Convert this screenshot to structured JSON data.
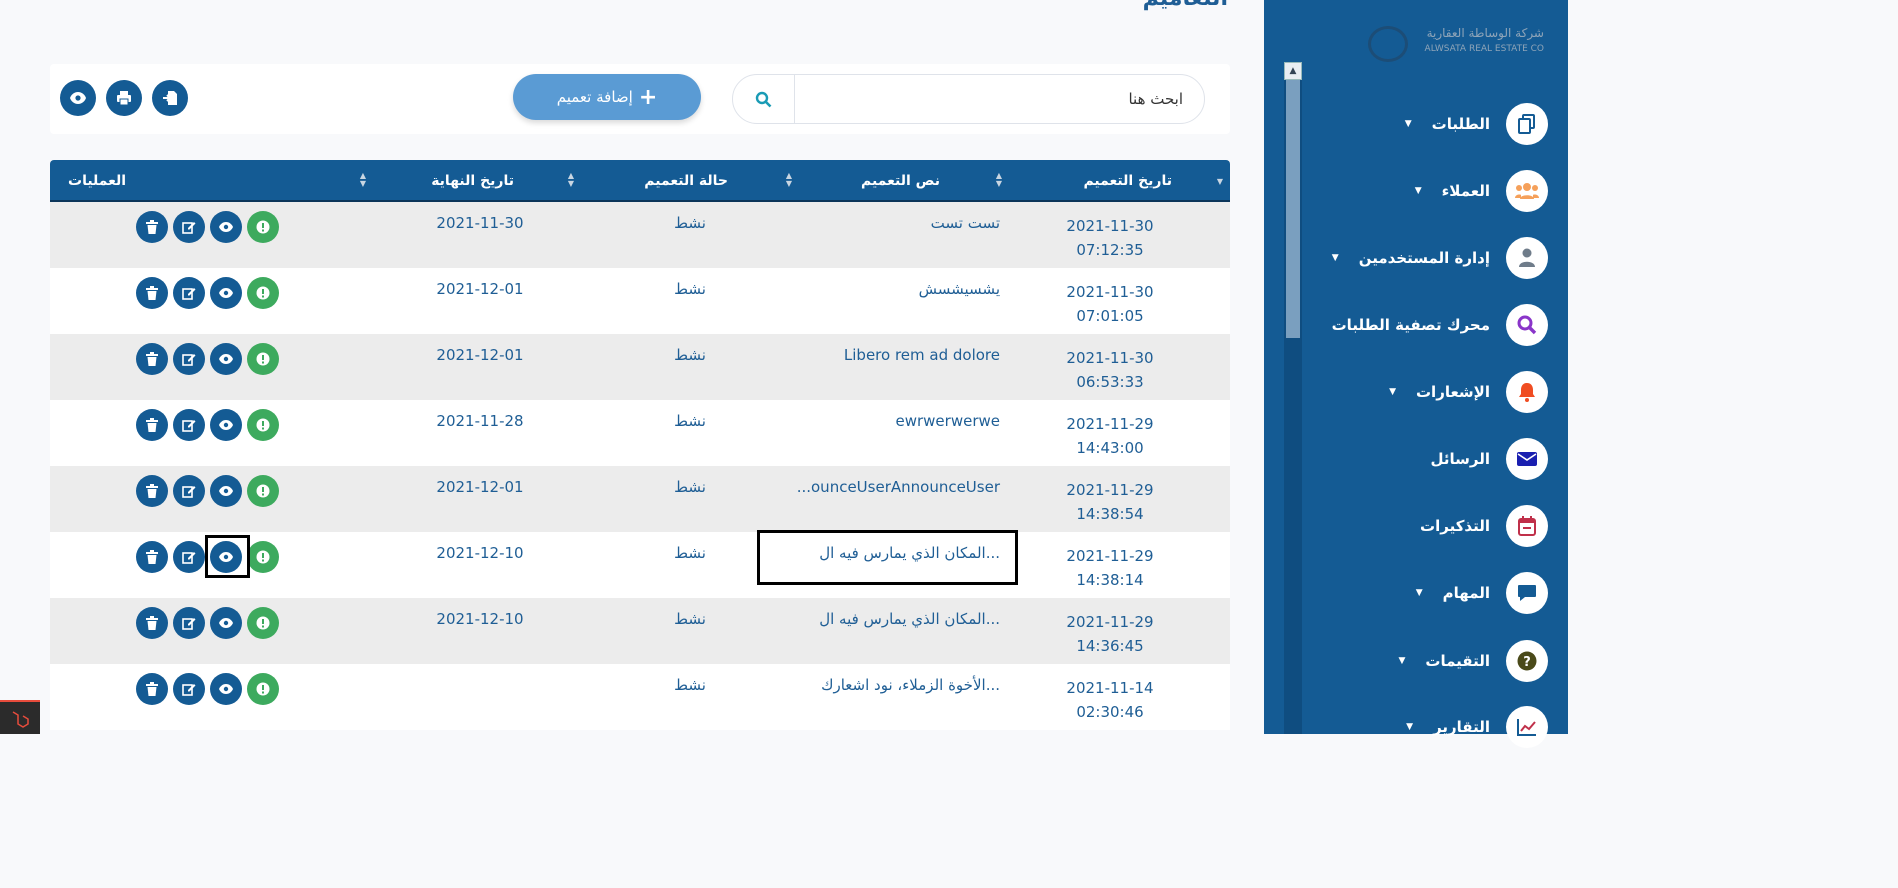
{
  "page": {
    "heading": "التعاميم"
  },
  "logo": {
    "line1": "شركة الوساطة العقارية",
    "line2": "ALWSATA REAL ESTATE CO"
  },
  "sidebar": {
    "items": [
      {
        "label": "الطلبات",
        "icon": "copy-icon",
        "has_caret": true
      },
      {
        "label": "العملاء",
        "icon": "users-icon",
        "has_caret": true
      },
      {
        "label": "إدارة المستخدمين",
        "icon": "user-icon",
        "has_caret": true
      },
      {
        "label": "محرك تصفية الطلبات",
        "icon": "search-icon",
        "has_caret": false
      },
      {
        "label": "الإشعارات",
        "icon": "bell-icon",
        "has_caret": true
      },
      {
        "label": "الرسائل",
        "icon": "envelope-icon",
        "has_caret": false
      },
      {
        "label": "التذكيرات",
        "icon": "calendar-icon",
        "has_caret": false
      },
      {
        "label": "المهام",
        "icon": "comment-icon",
        "has_caret": true
      },
      {
        "label": "التقيمات",
        "icon": "question-icon",
        "has_caret": true
      },
      {
        "label": "التقارير",
        "icon": "chart-icon",
        "has_caret": true
      }
    ]
  },
  "toolbar": {
    "search_placeholder": "ابحث هنا",
    "add_label": "إضافة تعميم",
    "buttons": [
      "export-icon",
      "print-icon",
      "eye-icon"
    ]
  },
  "table": {
    "headers": {
      "date": "تاريخ التعميم",
      "text": "نص التعميم",
      "status": "حالة التعميم",
      "end_date": "تاريخ النهاية",
      "ops": "العمليات"
    },
    "rows": [
      {
        "date": "2021-11-30",
        "time": "07:12:35",
        "text": "تست تست",
        "status": "نشط",
        "end_date": "2021-11-30"
      },
      {
        "date": "2021-11-30",
        "time": "07:01:05",
        "text": "يشسيشسش",
        "status": "نشط",
        "end_date": "2021-12-01"
      },
      {
        "date": "2021-11-30",
        "time": "06:53:33",
        "text": "Libero rem ad dolore",
        "status": "نشط",
        "end_date": "2021-12-01"
      },
      {
        "date": "2021-11-29",
        "time": "14:43:00",
        "text": "ewrwerwerwe",
        "status": "نشط",
        "end_date": "2021-11-28"
      },
      {
        "date": "2021-11-29",
        "time": "14:38:54",
        "text": "...ounceUserAnnounceUser",
        "status": "نشط",
        "end_date": "2021-12-01"
      },
      {
        "date": "2021-11-29",
        "time": "14:38:14",
        "text": "المكان الذي يمارس فيه ال...",
        "status": "نشط",
        "end_date": "2021-12-10"
      },
      {
        "date": "2021-11-29",
        "time": "14:36:45",
        "text": "المكان الذي يمارس فيه ال...",
        "status": "نشط",
        "end_date": "2021-12-10"
      },
      {
        "date": "2021-11-14",
        "time": "02:30:46",
        "text": "الأخوة الزملاء، نود اشعارك...",
        "status": "نشط",
        "end_date": ""
      }
    ]
  },
  "colors": {
    "primary": "#145b94",
    "success": "#3daa5e",
    "add_button": "#5a9bd4"
  }
}
